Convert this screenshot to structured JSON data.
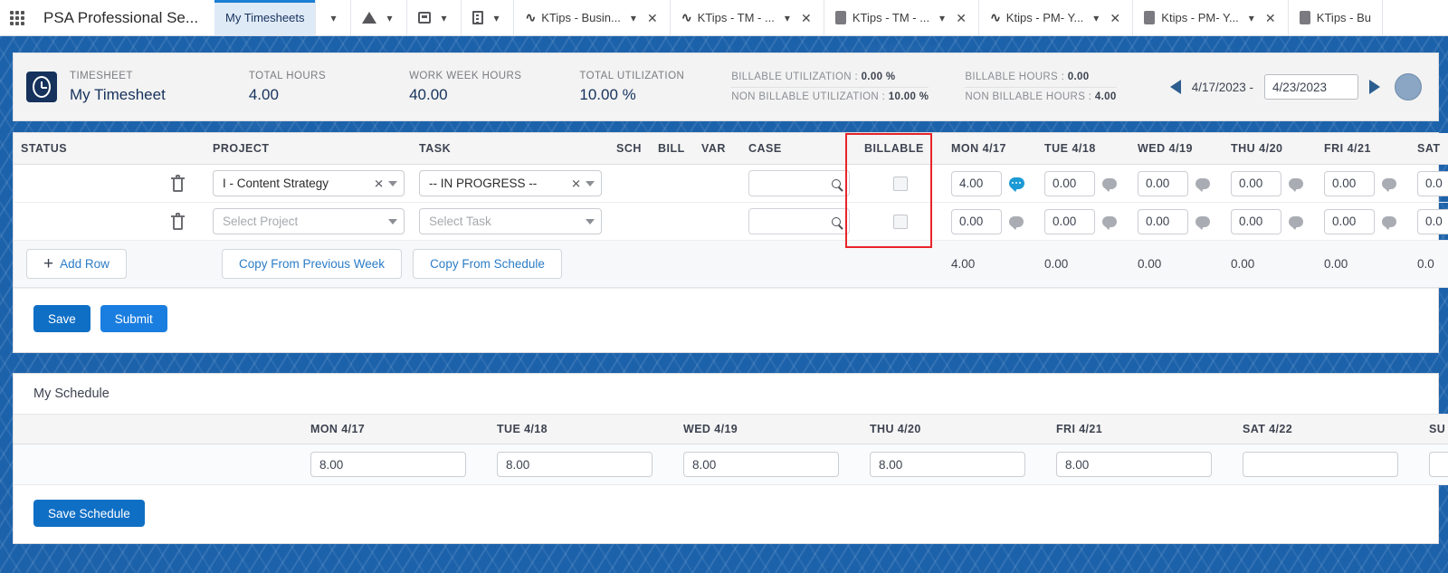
{
  "browser": {
    "app_title": "PSA Professional Se...",
    "waffle_icon": "app-launcher-icon",
    "tabs": [
      {
        "label": "My Timesheets",
        "icon": "none",
        "active": true,
        "closable": false
      },
      {
        "label": "",
        "icon": "triangle-icon",
        "active": false,
        "closable": false
      },
      {
        "label": "",
        "icon": "monitor-icon",
        "active": false,
        "closable": false
      },
      {
        "label": "",
        "icon": "document-icon",
        "active": false,
        "closable": false
      },
      {
        "label": "KTips - Busin...",
        "icon": "pulse-icon",
        "active": false,
        "closable": true
      },
      {
        "label": "KTips - TM - ...",
        "icon": "pulse-icon",
        "active": false,
        "closable": true
      },
      {
        "label": "KTips - TM - ...",
        "icon": "square-icon",
        "active": false,
        "closable": true
      },
      {
        "label": "Ktips - PM- Y...",
        "icon": "pulse-icon",
        "active": false,
        "closable": true
      },
      {
        "label": "Ktips - PM- Y...",
        "icon": "square-icon",
        "active": false,
        "closable": true
      },
      {
        "label": "KTips - Bu",
        "icon": "square-icon",
        "active": false,
        "closable": false
      }
    ]
  },
  "summary": {
    "badge_icon": "clock-icon",
    "timesheet_label": "TIMESHEET",
    "timesheet_name": "My Timesheet",
    "kpis": [
      {
        "label": "TOTAL HOURS",
        "value": "4.00"
      },
      {
        "label": "WORK WEEK HOURS",
        "value": "40.00"
      },
      {
        "label": "TOTAL UTILIZATION",
        "value": "10.00 %"
      }
    ],
    "pairs": [
      {
        "line1_label": "BILLABLE UTILIZATION :",
        "line1_value": "0.00 %",
        "line2_label": "NON BILLABLE UTILIZATION :",
        "line2_value": "10.00 %"
      },
      {
        "line1_label": "BILLABLE HOURS :",
        "line1_value": "0.00",
        "line2_label": "NON BILLABLE HOURS :",
        "line2_value": "4.00"
      }
    ],
    "date_prev_icon": "arrow-left-icon",
    "date_next_icon": "arrow-right-icon",
    "date_start": "4/17/2023 -",
    "date_end": "4/23/2023",
    "avatar": "user-avatar"
  },
  "timesheet": {
    "columns": [
      "STATUS",
      "",
      "PROJECT",
      "TASK",
      "SCH",
      "BILL",
      "VAR",
      "CASE",
      "BILLABLE",
      "MON 4/17",
      "TUE 4/18",
      "WED 4/19",
      "THU 4/20",
      "FRI 4/21",
      "SAT"
    ],
    "rows": [
      {
        "status": "",
        "delete_icon": "trash-icon",
        "project": "I - Content Strategy",
        "project_placeholder": "Select Project",
        "project_has_value": true,
        "task": "-- IN PROGRESS --",
        "task_placeholder": "Select Task",
        "task_has_value": true,
        "sch": "",
        "bill": "",
        "var": "",
        "case": "",
        "case_icon": "search-icon",
        "billable_checked": false,
        "hours": [
          "4.00",
          "0.00",
          "0.00",
          "0.00",
          "0.00",
          "0.0"
        ],
        "comments": [
          true,
          false,
          false,
          false,
          false,
          false
        ]
      },
      {
        "status": "",
        "delete_icon": "trash-icon",
        "project": "",
        "project_placeholder": "Select Project",
        "project_has_value": false,
        "task": "",
        "task_placeholder": "Select Task",
        "task_has_value": false,
        "sch": "",
        "bill": "",
        "var": "",
        "case": "",
        "case_icon": "search-icon",
        "billable_checked": false,
        "hours": [
          "0.00",
          "0.00",
          "0.00",
          "0.00",
          "0.00",
          "0.0"
        ],
        "comments": [
          false,
          false,
          false,
          false,
          false,
          false
        ]
      }
    ],
    "totals": [
      "4.00",
      "0.00",
      "0.00",
      "0.00",
      "0.00",
      "0.0"
    ],
    "buttons": {
      "add_row": "Add Row",
      "add_row_icon": "plus-icon",
      "copy_previous_week": "Copy From Previous Week",
      "copy_schedule": "Copy From Schedule",
      "save": "Save",
      "submit": "Submit"
    },
    "highlight_color": "#e8242a"
  },
  "schedule": {
    "title": "My Schedule",
    "columns": [
      "",
      "MON 4/17",
      "TUE 4/18",
      "WED 4/19",
      "THU 4/20",
      "FRI 4/21",
      "SAT 4/22",
      "SU"
    ],
    "values": [
      "8.00",
      "8.00",
      "8.00",
      "8.00",
      "8.00",
      "",
      ""
    ],
    "save_button": "Save Schedule"
  },
  "colors": {
    "banner_blue": "#1c62ab",
    "accent_blue": "#0f6fc5",
    "submit_blue": "#1a7ee0",
    "link_blue": "#2b7cc6",
    "navy": "#16325c",
    "comment_active": "#1c9ad6"
  }
}
